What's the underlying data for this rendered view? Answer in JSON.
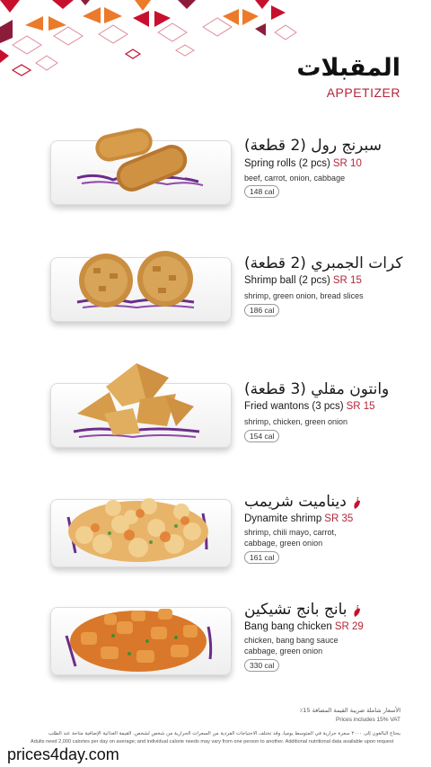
{
  "header": {
    "title_ar": "المقبلات",
    "title_en": "APPETIZER"
  },
  "colors": {
    "accent": "#b3263a",
    "pattern_red": "#c8102e",
    "pattern_orange": "#ec7a2a",
    "pattern_maroon": "#8c1d3a"
  },
  "items": [
    {
      "name_ar": "سبرنج رول (2 قطعة)",
      "name_en": "Spring rolls (2 pcs)",
      "price": "SR 10",
      "desc": "beef, carrot, onion, cabbage",
      "cal": "148 cal",
      "spicy": false
    },
    {
      "name_ar": "كرات الجمبري (2 قطعة)",
      "name_en": "Shrimp ball (2 pcs)",
      "price": "SR 15",
      "desc": "shrimp, green onion, bread slices",
      "cal": "186 cal",
      "spicy": false
    },
    {
      "name_ar": "وانتون مقلي (3 قطعة)",
      "name_en": "Fried wantons (3 pcs)",
      "price": "SR 15",
      "desc": "shrimp, chicken, green onion",
      "cal": "154 cal",
      "spicy": false
    },
    {
      "name_ar": "ديناميت شريمب",
      "name_en": "Dynamite shrimp",
      "price": "SR 35",
      "desc": "shrimp, chili mayo, carrot, cabbage, green onion",
      "cal": "161 cal",
      "spicy": true
    },
    {
      "name_ar": "بانج بانج تشيكين",
      "name_en": "Bang bang chicken",
      "price": "SR 29",
      "desc": "chicken, bang bang sauce cabbage, green onion",
      "cal": "330 cal",
      "spicy": true
    }
  ],
  "footer": {
    "vat_ar": "الأسعار شاملة ضريبة القيمة المضافة 15٪",
    "vat_en": "Prices includes 15% VAT",
    "note_ar": "يحتاج البالغون إلى ٢٠٠٠ سعرة حرارية في المتوسط يومياً، وقد تختلف الاحتياجات الفردية من السعرات الحرارية من شخص لشخص. القيمة الغذائية الإضافية متاحة عند الطلب",
    "note_en": "Adults need 2,000 calories per day on average; and individual calorie needs may vary from one person to another. Additional nutritional data available upon request"
  },
  "watermark": "prices4day.com"
}
